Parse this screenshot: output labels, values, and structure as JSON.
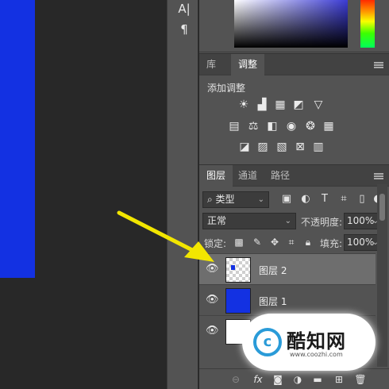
{
  "toolstrip": {
    "tools": [
      "A|",
      "¶"
    ]
  },
  "panels": {
    "top_tabs": [
      {
        "label": "库"
      },
      {
        "label": "调整"
      }
    ],
    "adjustments": {
      "title": "添加调整",
      "icons": [
        "brightness-icon",
        "levels-icon",
        "curves-icon",
        "exposure-icon",
        "vibrance-icon",
        "hue-saturation-icon",
        "color-balance-icon",
        "black-white-icon",
        "photo-filter-icon",
        "channel-mixer-icon",
        "color-lookup-icon",
        "invert-icon",
        "posterize-icon",
        "threshold-icon",
        "selective-color-icon",
        "gradient-map-icon"
      ]
    },
    "layer_tabs": [
      {
        "label": "图层"
      },
      {
        "label": "通道"
      },
      {
        "label": "路径"
      }
    ],
    "filter": {
      "kind_label": "类型"
    },
    "blend": {
      "mode": "正常",
      "opacity_label": "不透明度:",
      "opacity_value": "100%"
    },
    "lock": {
      "label": "锁定:",
      "fill_label": "填充:",
      "fill_value": "100%"
    },
    "layers": [
      {
        "name": "图层 2",
        "selected": true
      },
      {
        "name": "图层 1",
        "selected": false
      },
      {
        "name": "",
        "selected": false
      }
    ]
  },
  "watermark": {
    "name": "酷知网",
    "url": "www.coozhi.com"
  },
  "colors": {
    "canvas_blue": "#1331e2",
    "arrow": "#f2e600",
    "panel_bg": "#535353"
  }
}
